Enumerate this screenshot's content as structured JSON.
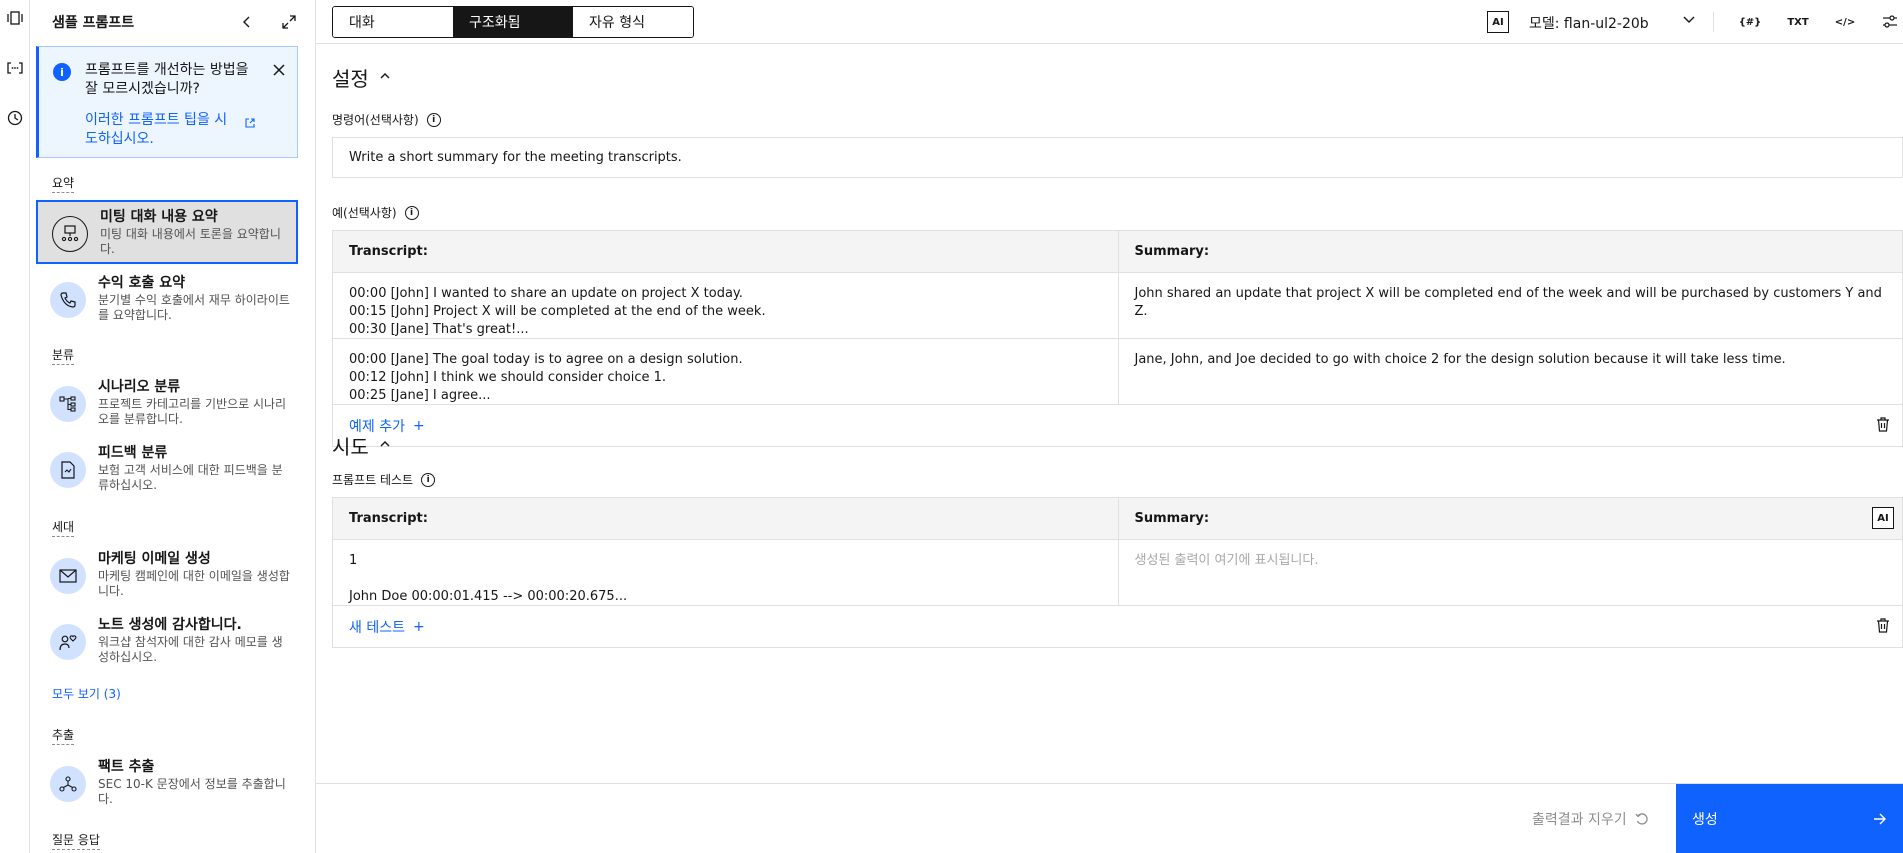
{
  "rail": {
    "icons": [
      "sample-prompts-icon",
      "prompt-variables-icon",
      "history-icon"
    ]
  },
  "sidebar": {
    "title": "샘플 프롬프트",
    "notice": {
      "text": "프롬프트를 개선하는 방법을 잘 모르시겠습니까?",
      "link": "이러한 프롬프트 팁을 시도하십시오."
    },
    "categories": {
      "summary": "요약",
      "classification": "분류",
      "generation": "세대",
      "extraction": "추출",
      "qa": "질문 응답"
    },
    "items": [
      {
        "title": "미팅 대화 내용 요약",
        "desc": "미팅 대화 내용에서 토론을 요약합니다.",
        "icon": "meeting-icon"
      },
      {
        "title": "수익 호출 요약",
        "desc": "분기별 수익 호출에서 재무 하이라이트를 요약합니다.",
        "icon": "phone-icon"
      },
      {
        "title": "시나리오 분류",
        "desc": "프로젝트 카테고리를 기반으로 시나리오를 분류합니다.",
        "icon": "tree-icon"
      },
      {
        "title": "피드백 분류",
        "desc": "보험 고객 서비스에 대한 피드백을 분류하십시오.",
        "icon": "document-icon"
      },
      {
        "title": "마케팅 이메일 생성",
        "desc": "마케팅 캠페인에 대한 이메일을 생성합니다.",
        "icon": "email-icon"
      },
      {
        "title": "노트 생성에 감사합니다.",
        "desc": "워크샵 참석자에 대한 감사 메모를 생성하십시오.",
        "icon": "person-heart-icon"
      },
      {
        "title": "팩트 추출",
        "desc": "SEC 10-K 문장에서 정보를 추출합니다.",
        "icon": "extract-icon"
      }
    ],
    "see_all": "모두 보기 (3)"
  },
  "topbar": {
    "tabs": [
      "대화",
      "구조화됨",
      "자유 형식"
    ],
    "active_tab": "구조화됨",
    "ai_badge": "AI",
    "model_label": "모델: flan-ul2-20b",
    "tools": {
      "variables": "{#}",
      "txt": "TXT",
      "code": "</>"
    }
  },
  "setup": {
    "title": "설정",
    "instruction_label": "명령어(선택사항)",
    "instruction_value": "Write a short summary for the meeting transcripts.",
    "examples_label": "예(선택사항)",
    "col_input": "Transcript:",
    "col_output": "Summary:",
    "examples": [
      {
        "input": "00:00   [John]   I wanted to share an update on project X today.\n00:15   [John]   Project X will be completed at the end of the week.\n00:30   [Jane]  That's great!...",
        "output": "John shared an update that project X will be completed end of the week and will be purchased by customers Y and Z."
      },
      {
        "input": "00:00   [Jane]   The goal today is to agree on a design solution.\n00:12   [John]  I think we should consider choice 1.\n00:25   [Jane]   I agree...",
        "output": "Jane, John, and Joe decided to go with choice 2 for the design solution because it will take less time."
      }
    ],
    "add_example": "예제 추가"
  },
  "try": {
    "title": "시도",
    "test_label": "프롬프트 테스트",
    "col_input": "Transcript:",
    "col_output": "Summary:",
    "ai_badge": "AI",
    "test_input": "1\n\nJohn Doe 00:00:01.415 --> 00:00:20.675...",
    "output_placeholder": "생성된 출력이 여기에 표시됩니다.",
    "new_test": "새 테스트"
  },
  "bottom": {
    "clear": "출력결과 지우기",
    "generate": "생성"
  },
  "colors": {
    "accent": "#0f62fe",
    "notice_bg": "#edf5ff",
    "icon_bg": "#d0e2ff"
  }
}
